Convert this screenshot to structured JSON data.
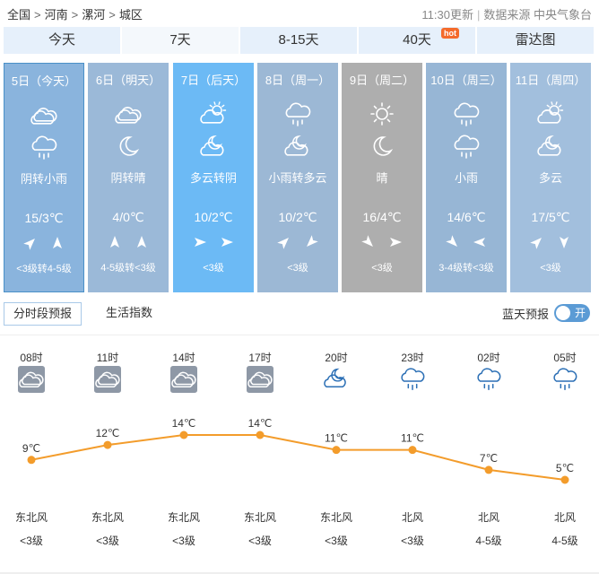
{
  "breadcrumb": {
    "items": [
      "全国",
      "河南",
      "漯河",
      "城区"
    ],
    "sep": ">"
  },
  "meta": {
    "updated": "11:30更新",
    "source_label": "数据来源 中央气象台"
  },
  "tabs": [
    {
      "label": "今天",
      "hot": ""
    },
    {
      "label": "7天",
      "hot": ""
    },
    {
      "label": "8-15天",
      "hot": ""
    },
    {
      "label": "40天",
      "hot": "hot"
    },
    {
      "label": "雷达图",
      "hot": ""
    }
  ],
  "days": [
    {
      "date": "5日（今天）",
      "desc": "阴转小雨",
      "temp": "15/3℃",
      "wind_level": "<3级转4-5级",
      "icon_day": "overcast-icon",
      "icon_night": "rain-icon",
      "bg": "#8ab4dd",
      "dir1": "northeast",
      "dir2": "north"
    },
    {
      "date": "6日（明天）",
      "desc": "阴转晴",
      "temp": "4/0℃",
      "wind_level": "4-5级转<3级",
      "icon_day": "overcast-icon",
      "icon_night": "moon-icon",
      "bg": "#9bb9d8",
      "dir1": "north",
      "dir2": "north"
    },
    {
      "date": "7日（后天）",
      "desc": "多云转阴",
      "temp": "10/2℃",
      "wind_level": "<3级",
      "icon_day": "partly-cloudy-icon",
      "icon_night": "partly-cloudy-night-icon",
      "bg": "#6cbaf5",
      "dir1": "east",
      "dir2": "east"
    },
    {
      "date": "8日（周一）",
      "desc": "小雨转多云",
      "temp": "10/2℃",
      "wind_level": "<3级",
      "icon_day": "rain-icon",
      "icon_night": "partly-cloudy-night-icon",
      "bg": "#9cb8d5",
      "dir1": "northeast",
      "dir2": "southwest"
    },
    {
      "date": "9日（周二）",
      "desc": "晴",
      "temp": "16/4℃",
      "wind_level": "<3级",
      "icon_day": "sun-icon",
      "icon_night": "moon-icon",
      "bg": "#aeaeae",
      "dir1": "southeast",
      "dir2": "east"
    },
    {
      "date": "10日（周三）",
      "desc": "小雨",
      "temp": "14/6℃",
      "wind_level": "3-4级转<3级",
      "icon_day": "rain-icon",
      "icon_night": "rain-icon",
      "bg": "#97b6d5",
      "dir1": "southeast",
      "dir2": "west"
    },
    {
      "date": "11日（周四）",
      "desc": "多云",
      "temp": "17/5℃",
      "wind_level": "<3级",
      "icon_day": "partly-cloudy-icon",
      "icon_night": "partly-cloudy-night-icon",
      "bg": "#a2bfdd",
      "dir1": "northeast",
      "dir2": "south"
    }
  ],
  "subtabs": {
    "hourly": "分时段预报",
    "life": "生活指数"
  },
  "bluesky": {
    "label": "蓝天预报",
    "toggle": "开"
  },
  "hourly": {
    "hours": [
      "08时",
      "11时",
      "14时",
      "17时",
      "20时",
      "23时",
      "02时",
      "05时"
    ],
    "icons": [
      "overcast-icon",
      "overcast-icon",
      "overcast-icon",
      "overcast-icon",
      "partly-cloudy-night-icon",
      "rain-icon",
      "rain-icon",
      "rain-icon"
    ],
    "temps": [
      9,
      12,
      14,
      14,
      11,
      11,
      7,
      5
    ],
    "temp_labels": [
      "9℃",
      "12℃",
      "14℃",
      "14℃",
      "11℃",
      "11℃",
      "7℃",
      "5℃"
    ],
    "wind_dirs": [
      "东北风",
      "东北风",
      "东北风",
      "东北风",
      "东北风",
      "北风",
      "北风",
      "北风"
    ],
    "wind_levels": [
      "<3级",
      "<3级",
      "<3级",
      "<3级",
      "<3级",
      "<3级",
      "4-5级",
      "4-5级"
    ]
  },
  "chart_data": {
    "type": "line",
    "x": [
      "08时",
      "11时",
      "14时",
      "17时",
      "20时",
      "23时",
      "02时",
      "05时"
    ],
    "series": [
      {
        "values": [
          9,
          12,
          14,
          14,
          11,
          11,
          7,
          5
        ]
      }
    ]
  },
  "colors": {
    "line": "#f39c2b",
    "tab_bg": "#e6f0fb",
    "toggle": "#5b9bd5",
    "accent": "#4a90c8"
  }
}
